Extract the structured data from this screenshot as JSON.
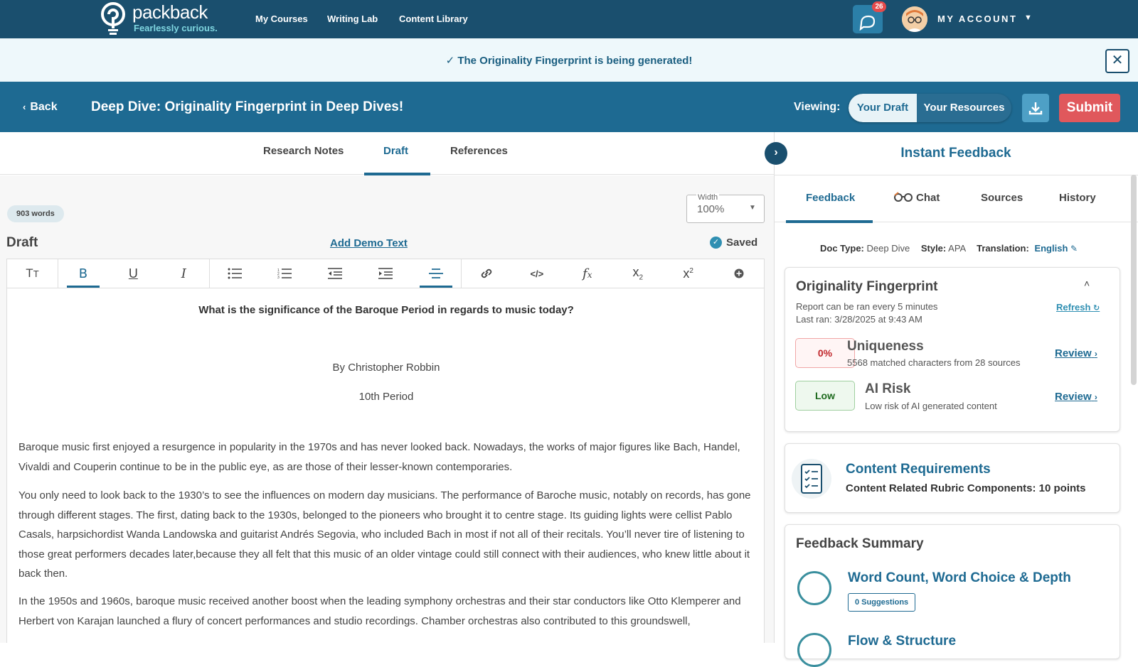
{
  "nav": {
    "logo_name": "packback",
    "logo_tagline": "Fearlessly curious.",
    "links": [
      "My Courses",
      "Writing Lab",
      "Content Library"
    ],
    "notification_count": "26",
    "account_label": "MY ACCOUNT"
  },
  "banner": {
    "message": "✓ The Originality Fingerprint is being generated!",
    "close_label": "✕"
  },
  "titlebar": {
    "back_label": "Back",
    "doc_title": "Deep Dive: Originality Fingerprint in Deep Dives!",
    "viewing_label": "Viewing:",
    "view_options": [
      "Your Draft",
      "Your Resources"
    ],
    "selected_view": "Your Draft",
    "submit_label": "Submit"
  },
  "tabs": {
    "items": [
      "Research Notes",
      "Draft",
      "References"
    ],
    "active": "Draft"
  },
  "editor": {
    "word_count": "903 words",
    "width_label": "Width",
    "width_value": "100%",
    "section_label": "Draft",
    "demo_link": "Add Demo Text",
    "save_status": "Saved",
    "toolbar": [
      "text-size",
      "bold",
      "underline",
      "italic",
      "bulleted-list",
      "numbered-list",
      "outdent",
      "indent",
      "align-center",
      "link",
      "code",
      "formula",
      "subscript",
      "superscript",
      "more"
    ],
    "question": "What is the significance of the Baroque Period in regards to music today?",
    "author": "By Christopher Robbin",
    "period": "10th Period",
    "paragraphs": [
      "Baroque music first enjoyed a resurgence in popularity in the 1970s and has never looked back. Nowadays, the works of major figures like Bach, Handel, Vivaldi and Couperin continue to be in the public eye, as are those of their lesser-known contemporaries.",
      "You only need to look back to the 1930’s to see the influences on modern day musicians.  The performance of Baroche music, notably on records, has gone through different stages. The first, dating back to the 1930s, belonged to the pioneers who brought it to centre stage. Its guiding lights were cellist Pablo Casals, harpsichordist Wanda Landowska and guitarist Andrés Segovia, who included Bach in most if not all of their recitals. You’ll never tire of listening to those great performers decades later,because they all felt that this music of an older vintage could still connect with their audiences, who knew little about it back then.",
      "In the 1950s and 1960s, baroque music received another boost when the leading symphony orchestras and their star conductors like Otto Klemperer and Herbert von Karajan launched a flury of concert performances and studio recordings. Chamber orchestras also contributed to this groundswell,"
    ]
  },
  "panel": {
    "title": "Instant Feedback",
    "tabs": [
      "Feedback",
      "Chat",
      "Sources",
      "History"
    ],
    "active_tab": "Feedback",
    "doc_type_label": "Doc Type:",
    "doc_type": "Deep Dive",
    "style_label": "Style:",
    "style": "APA",
    "translation_label": "Translation:",
    "translation": "English",
    "originality": {
      "title": "Originality Fingerprint",
      "frequency": "Report can be ran every 5 minutes",
      "last_ran": "Last ran: 3/28/2025 at 9:43 AM",
      "refresh_label": "Refresh",
      "uniqueness_value": "0%",
      "uniqueness_title": "Uniqueness",
      "uniqueness_sub": "5568 matched characters from 28 sources",
      "ai_value": "Low",
      "ai_title": "AI Risk",
      "ai_sub": "Low risk of AI generated content",
      "review_label": "Review"
    },
    "content_requirements": {
      "title": "Content Requirements",
      "sub": "Content Related Rubric Components: 10 points"
    },
    "feedback_summary": {
      "title": "Feedback Summary",
      "items": [
        {
          "name": "Word Count, Word Choice & Depth",
          "badge": "0 Suggestions"
        },
        {
          "name": "Flow & Structure"
        }
      ]
    }
  },
  "colors": {
    "nav": "#1a4f6e",
    "titlebar": "#1e6a92",
    "submit": "#e0585c",
    "accent": "#1e6a92"
  }
}
